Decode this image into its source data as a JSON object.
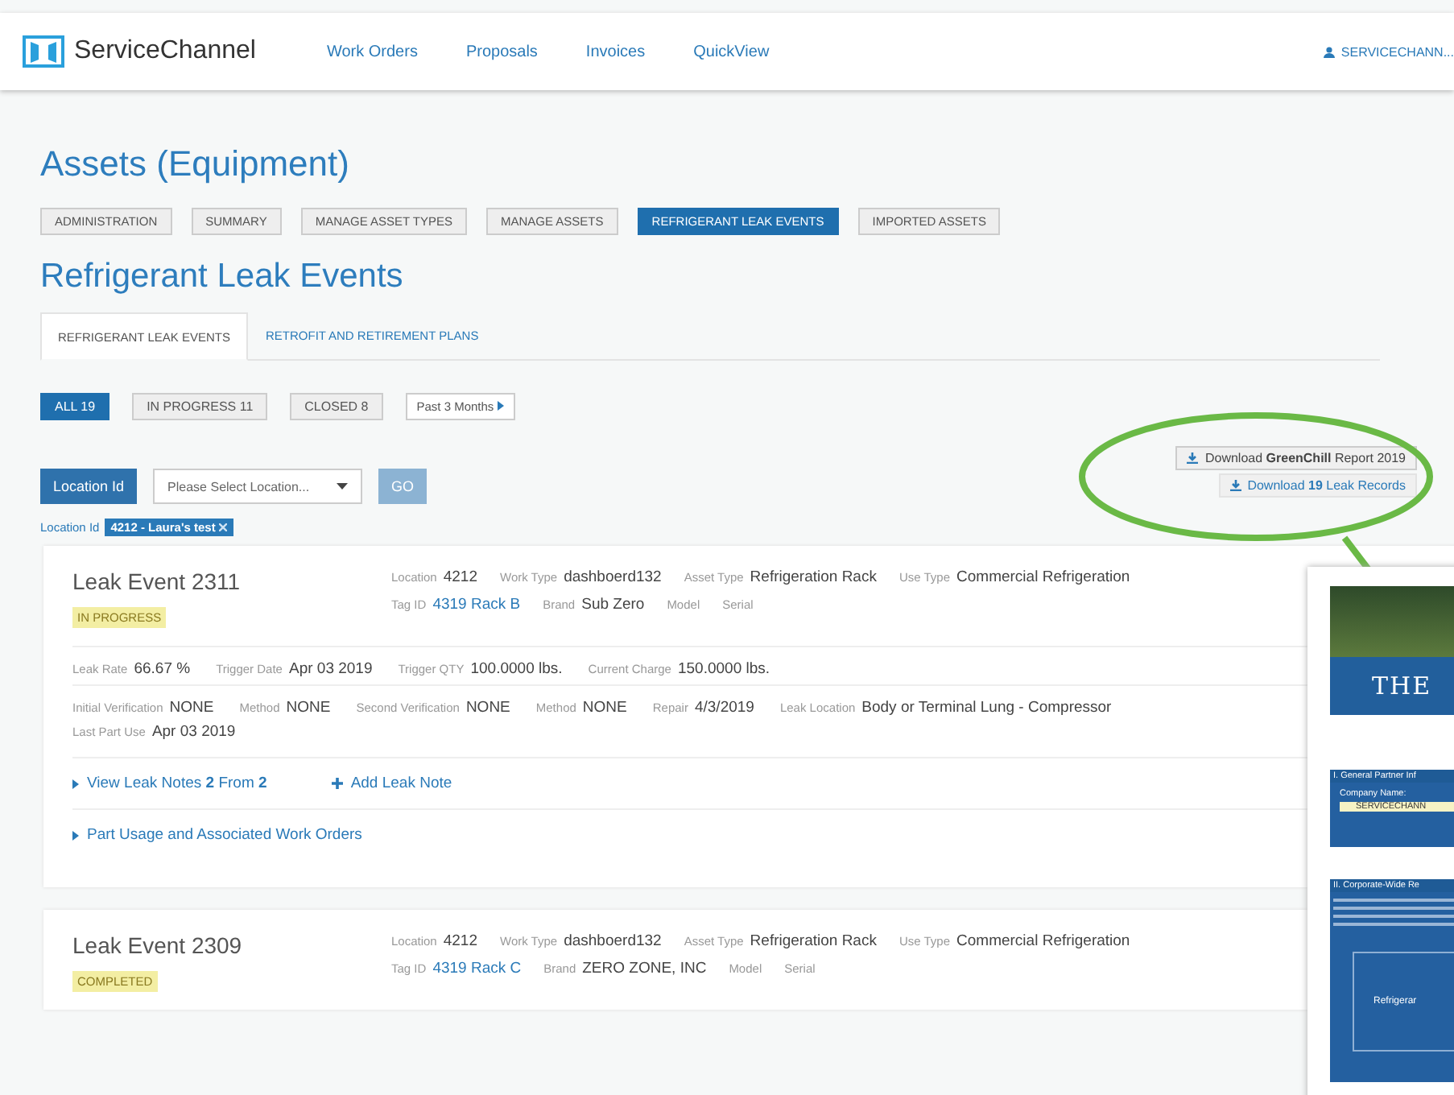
{
  "header": {
    "brand": "ServiceChannel",
    "nav": [
      {
        "label": "Work Orders"
      },
      {
        "label": "Proposals"
      },
      {
        "label": "Invoices"
      },
      {
        "label": "QuickView"
      }
    ],
    "user": "SERVICECHANN..."
  },
  "page_title": "Assets (Equipment)",
  "section_tabs": [
    {
      "label": "ADMINISTRATION",
      "selected": false
    },
    {
      "label": "SUMMARY",
      "selected": false
    },
    {
      "label": "MANAGE ASSET TYPES",
      "selected": false
    },
    {
      "label": "MANAGE ASSETS",
      "selected": false
    },
    {
      "label": "REFRIGERANT LEAK EVENTS",
      "selected": true
    },
    {
      "label": "IMPORTED ASSETS",
      "selected": false
    }
  ],
  "section_title": "Refrigerant Leak Events",
  "sub_tabs": [
    {
      "label": "REFRIGERANT LEAK EVENTS",
      "selected": true
    },
    {
      "label": "RETROFIT AND RETIREMENT PLANS",
      "selected": false
    }
  ],
  "filters": [
    {
      "label": "ALL 19",
      "selected": true
    },
    {
      "label": "IN PROGRESS 11",
      "selected": false
    },
    {
      "label": "CLOSED 8",
      "selected": false
    }
  ],
  "period": "Past 3 Months",
  "location_button": "Location Id",
  "location_select": {
    "placeholder": "Please Select Location..."
  },
  "go_button": "GO",
  "downloads": [
    {
      "label": "Download **GreenChill** Report 2019"
    },
    {
      "label": "Download **19** Leak Records"
    }
  ],
  "location_filter": {
    "label": "Location Id",
    "chip": "4212 - Laura's test"
  },
  "events": [
    {
      "title": "Leak Event 2311",
      "status": "IN PROGRESS",
      "fields": [
        [
          {
            "label": "Location",
            "value": "4212"
          },
          {
            "label": "Work Type",
            "value": "dashboerd132"
          },
          {
            "label": "Asset Type",
            "value": "Refrigeration Rack"
          },
          {
            "label": "Use Type",
            "value": "Commercial Refrigeration"
          }
        ],
        [
          {
            "label": "Tag ID",
            "value": "4319 Rack B",
            "link": true
          },
          {
            "label": "Brand",
            "value": "Sub Zero"
          },
          {
            "label": "Model"
          },
          {
            "label": "Serial"
          }
        ]
      ],
      "details": [
        [
          {
            "label": "Leak Rate",
            "value": "66.67 %"
          },
          {
            "label": "Trigger Date",
            "value": "Apr 03 2019"
          },
          {
            "label": "Trigger QTY",
            "value": "100.0000 lbs."
          },
          {
            "label": "Current Charge",
            "value": "150.0000 lbs."
          }
        ],
        [
          {
            "label": "Initial Verification",
            "value": "NONE"
          },
          {
            "label": "Method",
            "value": "NONE"
          },
          {
            "label": "Second Verification",
            "value": "NONE"
          },
          {
            "label": "Method",
            "value": "NONE"
          },
          {
            "label": "Repair",
            "value": "4/3/2019"
          },
          {
            "label": "Leak Location",
            "value": "Body or Terminal Lung - Compressor"
          }
        ],
        [
          {
            "label": "Last Part Use",
            "value": "Apr 03 2019"
          }
        ]
      ],
      "notes_link": "View Leak Notes **2** From **2**",
      "add_note": "Add Leak Note",
      "parts_link": "Part Usage and Associated Work Orders"
    },
    {
      "title": "Leak Event 2309",
      "status": "COMPLETED",
      "fields": [
        [
          {
            "label": "Location",
            "value": "4212"
          },
          {
            "label": "Work Type",
            "value": "dashboerd132"
          },
          {
            "label": "Asset Type",
            "value": "Refrigeration Rack"
          },
          {
            "label": "Use Type",
            "value": "Commercial Refrigeration"
          }
        ],
        [
          {
            "label": "Tag ID",
            "value": "4319 Rack C",
            "link": true
          },
          {
            "label": "Brand",
            "value": "ZERO ZONE, INC"
          },
          {
            "label": "Model"
          },
          {
            "label": "Serial"
          }
        ]
      ]
    }
  ],
  "report_preview": {
    "banner": "THE",
    "section_1": "I. General Partner Inf",
    "company_label": "Company Name:",
    "company_value": "SERVICECHANN",
    "section_2": "II. Corporate-Wide Re",
    "table_label": "Refrigerar"
  }
}
